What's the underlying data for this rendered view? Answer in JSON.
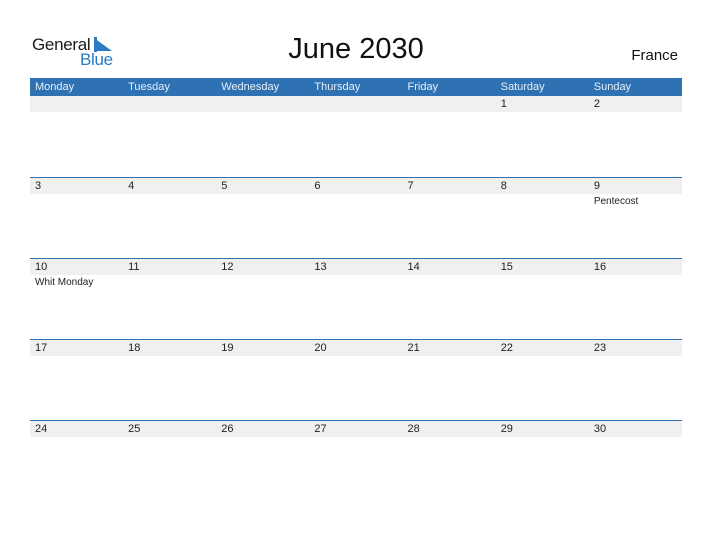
{
  "logo": {
    "general": "General",
    "blue": "Blue",
    "icon": "triangle-flag-icon",
    "brand_color": "#2a7bc4"
  },
  "title": "June 2030",
  "country": "France",
  "header_color": "#2f72b3",
  "days_of_week": [
    "Monday",
    "Tuesday",
    "Wednesday",
    "Thursday",
    "Friday",
    "Saturday",
    "Sunday"
  ],
  "weeks": [
    [
      {
        "day": ""
      },
      {
        "day": ""
      },
      {
        "day": ""
      },
      {
        "day": ""
      },
      {
        "day": ""
      },
      {
        "day": "1"
      },
      {
        "day": "2"
      }
    ],
    [
      {
        "day": "3"
      },
      {
        "day": "4"
      },
      {
        "day": "5"
      },
      {
        "day": "6"
      },
      {
        "day": "7"
      },
      {
        "day": "8"
      },
      {
        "day": "9",
        "event": "Pentecost"
      }
    ],
    [
      {
        "day": "10",
        "event": "Whit Monday"
      },
      {
        "day": "11"
      },
      {
        "day": "12"
      },
      {
        "day": "13"
      },
      {
        "day": "14"
      },
      {
        "day": "15"
      },
      {
        "day": "16"
      }
    ],
    [
      {
        "day": "17"
      },
      {
        "day": "18"
      },
      {
        "day": "19"
      },
      {
        "day": "20"
      },
      {
        "day": "21"
      },
      {
        "day": "22"
      },
      {
        "day": "23"
      }
    ],
    [
      {
        "day": "24"
      },
      {
        "day": "25"
      },
      {
        "day": "26"
      },
      {
        "day": "27"
      },
      {
        "day": "28"
      },
      {
        "day": "29"
      },
      {
        "day": "30"
      }
    ]
  ]
}
